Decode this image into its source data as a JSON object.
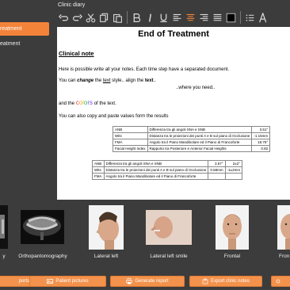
{
  "sidebar": {
    "items": [
      {
        "label": "reatment"
      },
      {
        "label": "eatment"
      }
    ]
  },
  "diary": {
    "title": "Clinic diary",
    "toolbar": [
      "undo-icon",
      "redo-icon",
      "cut-icon",
      "copy-icon",
      "paste-icon",
      "bold-icon",
      "italic-icon",
      "underline-icon",
      "align-left-icon",
      "align-center-icon",
      "align-right-icon",
      "justify-icon",
      "text-color-icon",
      "list-icon",
      "font-size-icon"
    ],
    "doc": {
      "title": "End of Treatment",
      "subtitle": "Clinical note",
      "p1": "Here is possible write all your notes. Each time step have a separated document.",
      "p2_pre": "You can ",
      "p2_change": "change",
      "p2_mid": " the ",
      "p2_text": "text",
      "p2_mid2": " style.. align the ",
      "p2_text2": "text",
      "p2_end": "..",
      "p3": "..where you need..",
      "p4_pre": "and the ",
      "p4_colors": [
        "c",
        "o",
        "l",
        "o",
        "r",
        "s"
      ],
      "p4_end": " of the text.",
      "p5": "You can also copy and paste values form the results",
      "table1": [
        [
          "ANB",
          "Differenza tra gli angoli SNA e SNB",
          "3.51°"
        ],
        [
          "Wits",
          "Distanza tra le proiezioni dei punti A e B sul piano di Occlusione",
          "-1.15mm"
        ],
        [
          "FMA",
          "Angolo tra il Piano Mandibolare ed il Piano di Francoforte",
          "18.75°"
        ],
        [
          "Facial Height Index",
          "Rapporto tra Posteriore e Anterior Facial Heights",
          "0.82"
        ]
      ],
      "table2": [
        [
          "ANB",
          "Differenza tra gli angoli SNA e SNB",
          "3.57°",
          "2±2°"
        ],
        [
          "Wits",
          "Distanza tra le proiezioni dei punti A e B sul piano di Occlusione",
          "0.58mm",
          "-1±2mm"
        ],
        [
          "FMA",
          "Angolo tra il Piano Mandibolare ed il Piano di Francoforte",
          "",
          ""
        ]
      ]
    }
  },
  "gallery": {
    "items": [
      {
        "label": "y"
      },
      {
        "label": "Orthopantomography"
      },
      {
        "label": "Lateral left"
      },
      {
        "label": "Lateral left smile"
      },
      {
        "label": "Frontal"
      },
      {
        "label": "Fron"
      }
    ]
  },
  "bottom_buttons": [
    {
      "label": "ports"
    },
    {
      "label": "Patient pictures"
    },
    {
      "label": "Generate report"
    },
    {
      "label": "Export clinic notes"
    },
    {
      "label": ""
    }
  ],
  "colors": {
    "accent": "#f4833a",
    "background": "#3c3c3c",
    "word_colors": [
      "#e8423a",
      "#f2a33a",
      "#f2d23a",
      "#3ab04a",
      "#3a7ee8",
      "#9a3ae8"
    ]
  }
}
